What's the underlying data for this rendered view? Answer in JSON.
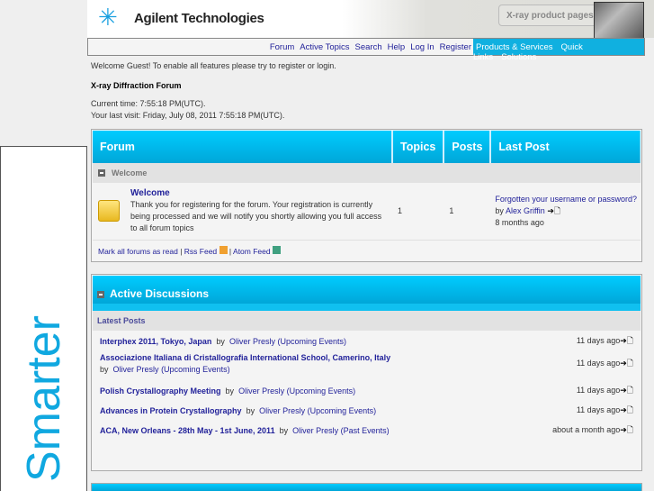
{
  "side_text": "Smarter",
  "header": {
    "logo": "Agilent Technologies",
    "xray": "X-ray product pages"
  },
  "nav": {
    "links": [
      "Forum",
      "Active Topics",
      "Search",
      "Help",
      "Log In",
      "Register"
    ],
    "right": [
      "Products & Services",
      "Quick Links",
      "Solutions"
    ]
  },
  "welcome_msg": "Welcome Guest! To enable all features please try to register or login.",
  "forum_title": "X-ray Diffraction Forum",
  "current_time": "Current time: 7:55:18 PM(UTC).",
  "last_visit": "Your last visit: Friday, July 08, 2011 7:55:18 PM(UTC).",
  "forum_table": {
    "headers": [
      "Forum",
      "Topics",
      "Posts",
      "Last Post"
    ],
    "category": "Welcome",
    "row": {
      "name": "Welcome",
      "desc": "Thank you for registering for the forum. Your registration is currently being processed and we will notify you shortly allowing you full access to all forum topics",
      "topics": "1",
      "posts": "1",
      "last_title": "Forgotten your username or password?",
      "by": "by",
      "last_author": "Alex Griffin",
      "last_time": "8 months ago"
    },
    "footer": {
      "mark": "Mark all forums as read",
      "rss": "Rss Feed",
      "atom": "Atom Feed",
      "sep": "|"
    }
  },
  "active": {
    "title": "Active Discussions",
    "sub": "Latest Posts",
    "posts": [
      {
        "title": "Interphex 2011, Tokyo, Japan",
        "by": "by",
        "author": "Oliver Presly",
        "cat": "(Upcoming Events)",
        "time": "11 days ago"
      },
      {
        "title": "Associazione Italiana di Cristallografia International School, Camerino, Italy",
        "by": "by",
        "author": "Oliver Presly",
        "cat": "(Upcoming Events)",
        "time": "11 days ago"
      },
      {
        "title": "Polish Crystallography Meeting",
        "by": "by",
        "author": "Oliver Presly",
        "cat": "(Upcoming Events)",
        "time": "11 days ago"
      },
      {
        "title": "Advances in Protein Crystallography",
        "by": "by",
        "author": "Oliver Presly",
        "cat": "(Upcoming Events)",
        "time": "11 days ago"
      },
      {
        "title": "ACA, New Orleans - 28th May - 1st June, 2011",
        "by": "by",
        "author": "Oliver Presly",
        "cat": "(Past Events)",
        "time": "about a month ago"
      }
    ]
  }
}
